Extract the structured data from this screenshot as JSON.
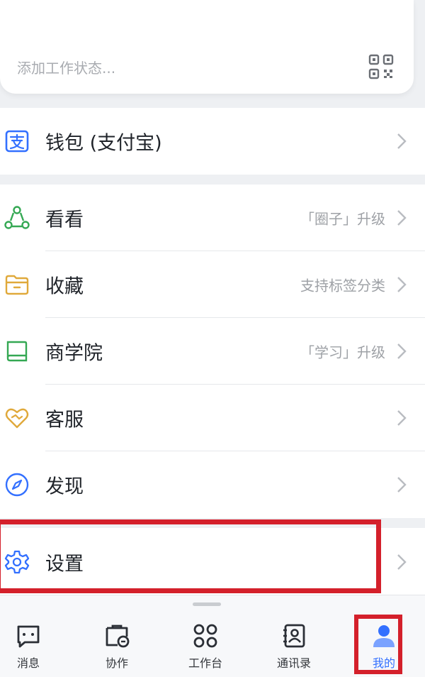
{
  "status": {
    "placeholder": "添加工作状态...",
    "qr_icon": "qr-code-icon"
  },
  "wallet": {
    "label": "钱包 (支付宝)",
    "icon": "alipay-wallet-icon",
    "color": "#3370ff"
  },
  "menu": [
    {
      "id": "kankan",
      "label": "看看",
      "hint": "「圈子」升级",
      "icon": "community-icon",
      "color": "#34a853"
    },
    {
      "id": "favorites",
      "label": "收藏",
      "hint": "支持标签分类",
      "icon": "folder-icon",
      "color": "#e0a93b"
    },
    {
      "id": "academy",
      "label": "商学院",
      "hint": "「学习」升级",
      "icon": "book-icon",
      "color": "#34a853"
    },
    {
      "id": "support",
      "label": "客服",
      "hint": "",
      "icon": "heart-handshake-icon",
      "color": "#e0a93b"
    },
    {
      "id": "discover",
      "label": "发现",
      "hint": "",
      "icon": "compass-icon",
      "color": "#3370ff"
    }
  ],
  "settings": {
    "label": "设置",
    "icon": "gear-icon",
    "color": "#3370ff"
  },
  "tabs": [
    {
      "id": "messages",
      "label": "消息",
      "icon": "message-icon"
    },
    {
      "id": "collab",
      "label": "协作",
      "icon": "collaboration-icon"
    },
    {
      "id": "workbench",
      "label": "工作台",
      "icon": "grid-icon"
    },
    {
      "id": "contacts",
      "label": "通讯录",
      "icon": "contacts-icon"
    },
    {
      "id": "me",
      "label": "我的",
      "icon": "person-icon",
      "active": true
    }
  ],
  "colors": {
    "accent": "#3370ff",
    "highlight": "#d4202b"
  }
}
